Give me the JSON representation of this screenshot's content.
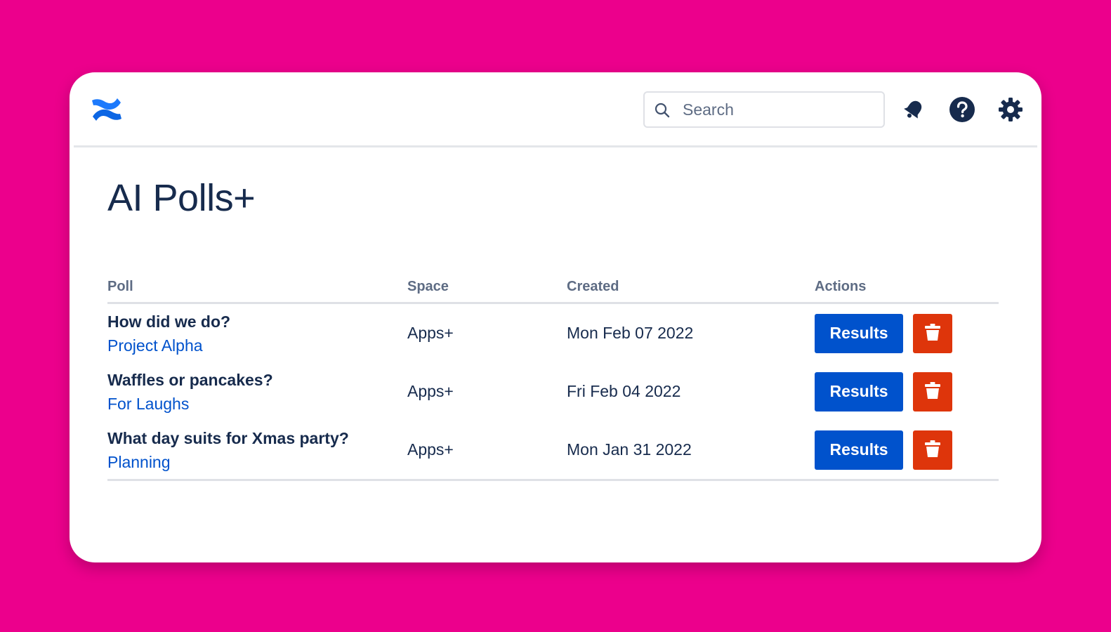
{
  "header": {
    "logo_icon": "confluence-logo-icon",
    "search": {
      "placeholder": "Search",
      "value": ""
    },
    "icons": [
      "notifications-bell-icon",
      "help-icon",
      "settings-gear-icon"
    ]
  },
  "page": {
    "title": "AI Polls+"
  },
  "table": {
    "columns": [
      "Poll",
      "Space",
      "Created",
      "Actions"
    ],
    "rows": [
      {
        "poll": "How did we do?",
        "page": "Project Alpha",
        "space": "Apps+",
        "created": "Mon Feb 07 2022",
        "results_label": "Results"
      },
      {
        "poll": "Waffles or pancakes?",
        "page": "For Laughs",
        "space": "Apps+",
        "created": "Fri Feb 04 2022",
        "results_label": "Results"
      },
      {
        "poll": "What day suits for Xmas party?",
        "page": "Planning",
        "space": "Apps+",
        "created": "Mon Jan 31 2022",
        "results_label": "Results"
      }
    ]
  },
  "colors": {
    "background": "#EC008C",
    "primary": "#0052CC",
    "danger": "#DE350B",
    "text": "#172B4D",
    "subtle_text": "#5E6C84"
  }
}
